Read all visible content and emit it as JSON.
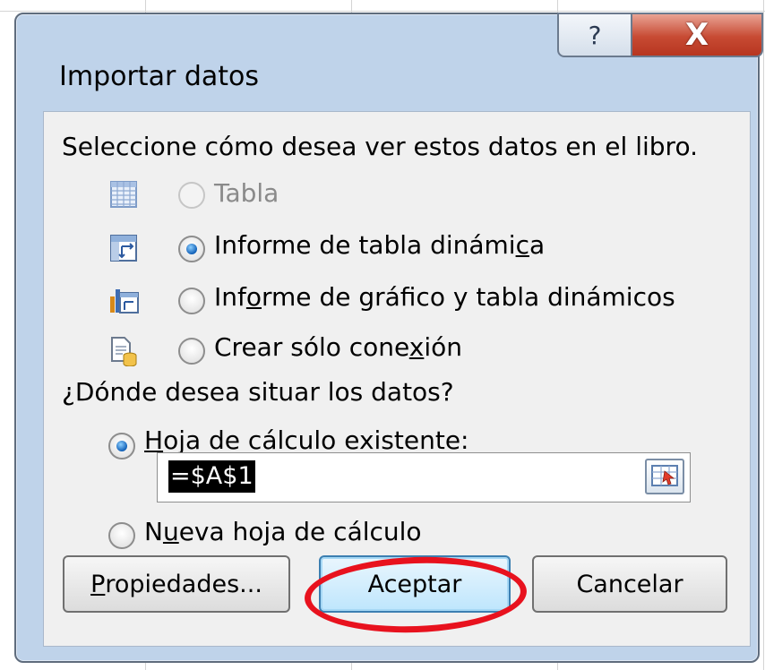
{
  "dialog": {
    "title": "Importar datos",
    "help_glyph": "?",
    "close_glyph": "X"
  },
  "view_section": {
    "prompt": "Seleccione cómo desea ver estos datos en el libro.",
    "options": [
      {
        "label": "Tabla",
        "icon": "table-icon",
        "enabled": false,
        "selected": false
      },
      {
        "label_pre": "Informe de tabla dinámi",
        "label_ul": "c",
        "label_post": "a",
        "icon": "pivot-table-icon",
        "enabled": true,
        "selected": true
      },
      {
        "label_pre": "Inf",
        "label_ul": "o",
        "label_post": "rme de gráfico y tabla dinámicos",
        "icon": "pivot-chart-icon",
        "enabled": true,
        "selected": false
      },
      {
        "label_pre": "Crear sólo cone",
        "label_ul": "x",
        "label_post": "ión",
        "icon": "connection-only-icon",
        "enabled": true,
        "selected": false
      }
    ]
  },
  "location_section": {
    "prompt": "¿Dónde desea situar los datos?",
    "existing_ul": "H",
    "existing_rest": "oja de cálculo existente:",
    "existing_selected": true,
    "reference_value": "=$A$1",
    "new_pre": "N",
    "new_ul": "u",
    "new_post": "eva hoja de cálculo",
    "new_selected": false
  },
  "buttons": {
    "properties_ul": "P",
    "properties_rest": "ropiedades...",
    "accept": "Aceptar",
    "cancel": "Cancelar"
  },
  "colors": {
    "annotation_ring": "#e8121e",
    "close_button": "#c74a33",
    "frame": "#bfd3ea"
  }
}
